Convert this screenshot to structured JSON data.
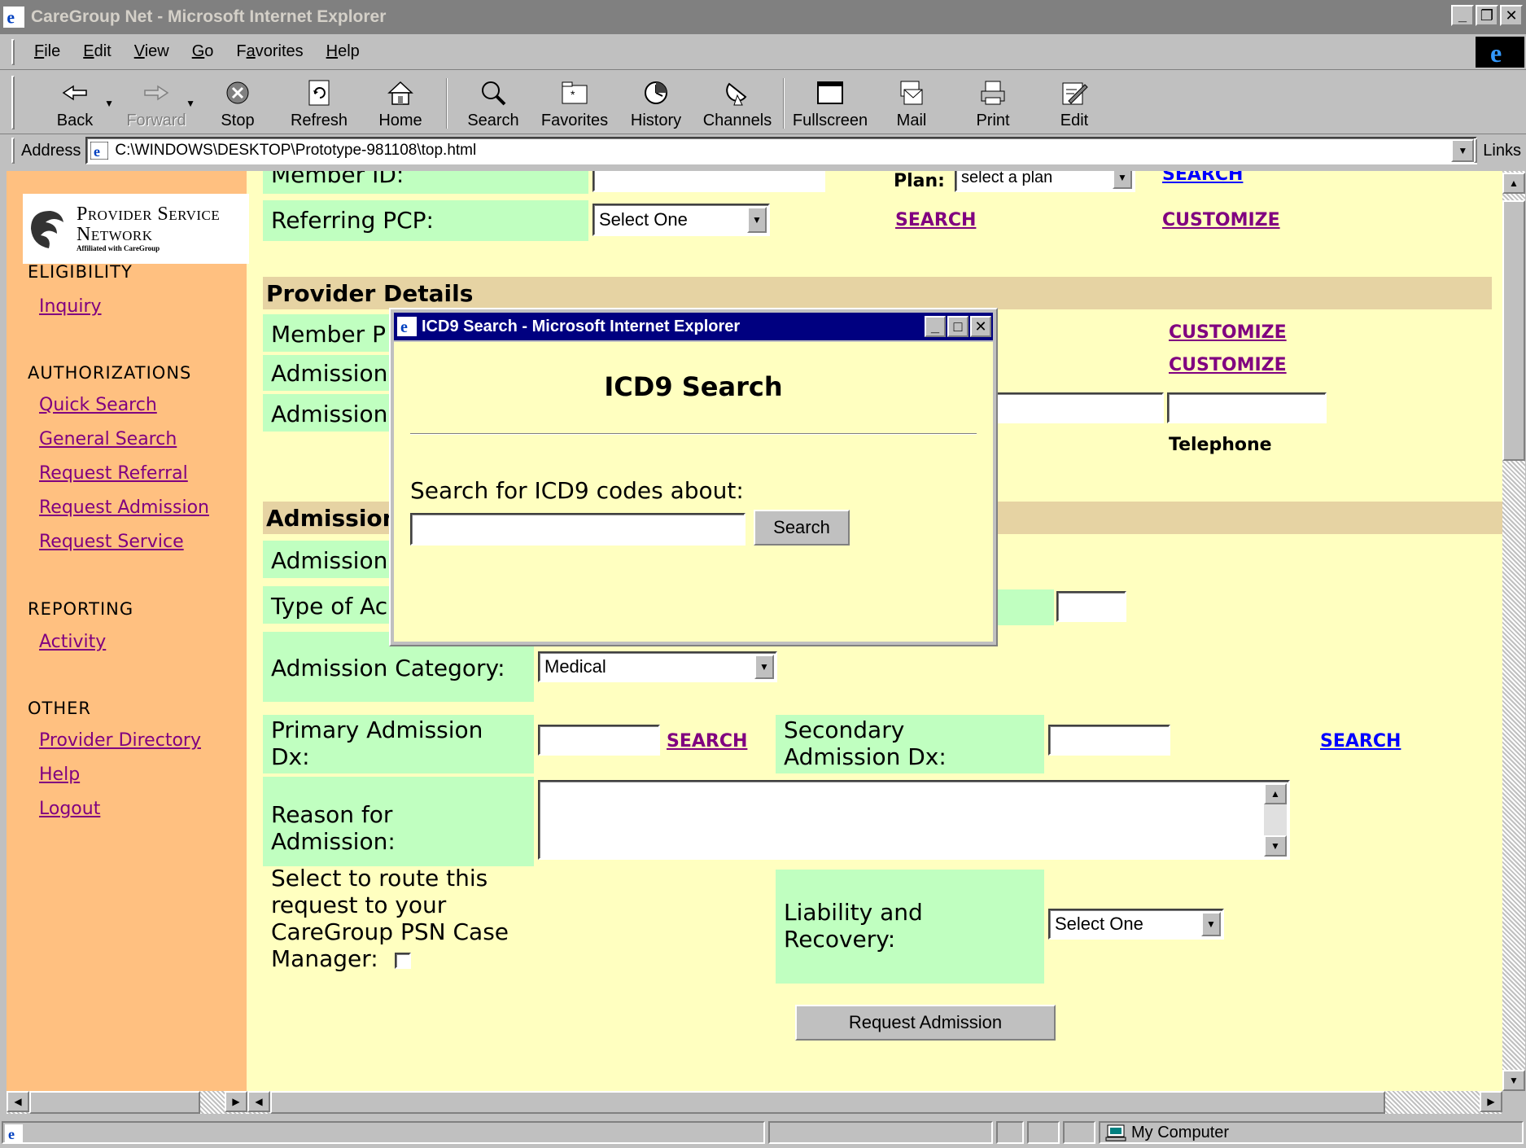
{
  "window": {
    "title": "CareGroup Net - Microsoft Internet Explorer",
    "controls": {
      "minimize": "_",
      "maximize": "□",
      "close": "✕"
    }
  },
  "menu": {
    "items": [
      {
        "label": "File",
        "key": "F"
      },
      {
        "label": "Edit",
        "key": "E"
      },
      {
        "label": "View",
        "key": "V"
      },
      {
        "label": "Go",
        "key": "G"
      },
      {
        "label": "Favorites",
        "key": "a"
      },
      {
        "label": "Help",
        "key": "H"
      }
    ]
  },
  "toolbar": {
    "back": "Back",
    "forward": "Forward",
    "stop": "Stop",
    "refresh": "Refresh",
    "home": "Home",
    "search": "Search",
    "favorites": "Favorites",
    "history": "History",
    "channels": "Channels",
    "fullscreen": "Fullscreen",
    "mail": "Mail",
    "print": "Print",
    "edit": "Edit"
  },
  "address": {
    "label": "Address",
    "value": "C:\\WINDOWS\\DESKTOP\\Prototype-981108\\top.html",
    "links": "Links"
  },
  "sidebar": {
    "logo": {
      "line1": "Provider Service",
      "line2": "Network",
      "line3": "Affiliated with CareGroup"
    },
    "eligibility": {
      "heading": "ELIGIBILITY",
      "links": [
        "Inquiry"
      ]
    },
    "authorizations": {
      "heading": "AUTHORIZATIONS",
      "links": [
        "Quick Search",
        "General Search",
        "Request Referral",
        "Request Admission",
        "Request Service"
      ]
    },
    "reporting": {
      "heading": "REPORTING",
      "links": [
        "Activity"
      ]
    },
    "other": {
      "heading": "OTHER",
      "links": [
        "Provider Directory",
        "Help",
        "Logout"
      ]
    }
  },
  "form": {
    "member_id_label": "Member ID:",
    "plan_label": "Plan:",
    "plan_select": "select a plan",
    "search_top": "SEARCH",
    "referring_pcp_label": "Referring PCP:",
    "referring_pcp_select": "Select One",
    "search": "SEARCH",
    "customize": "CUSTOMIZE",
    "provider_details_header": "Provider Details",
    "member_pcp_label": "Member P",
    "admission_label_1": "Admission",
    "admission_label_2": "Admission",
    "telephone_label": "Telephone",
    "admission_header": "Admission",
    "admission_label_3": "Admission",
    "type_of_label": "Type of Ac",
    "admission_category_label": "Admission Category:",
    "admission_category_value": "Medical",
    "primary_dx_label": "Primary Admission Dx:",
    "secondary_dx_label": "Secondary Admission Dx:",
    "reason_label": "Reason for Admission:",
    "route_label": "Select to route this request to your CareGroup PSN Case Manager:",
    "liability_label": "Liability and Recovery:",
    "liability_select": "Select One",
    "submit": "Request Admission"
  },
  "popup": {
    "title": "ICD9 Search - Microsoft Internet Explorer",
    "heading": "ICD9 Search",
    "prompt": "Search for ICD9 codes about:",
    "input_value": "",
    "button": "Search"
  },
  "status": {
    "zone": "My Computer"
  }
}
